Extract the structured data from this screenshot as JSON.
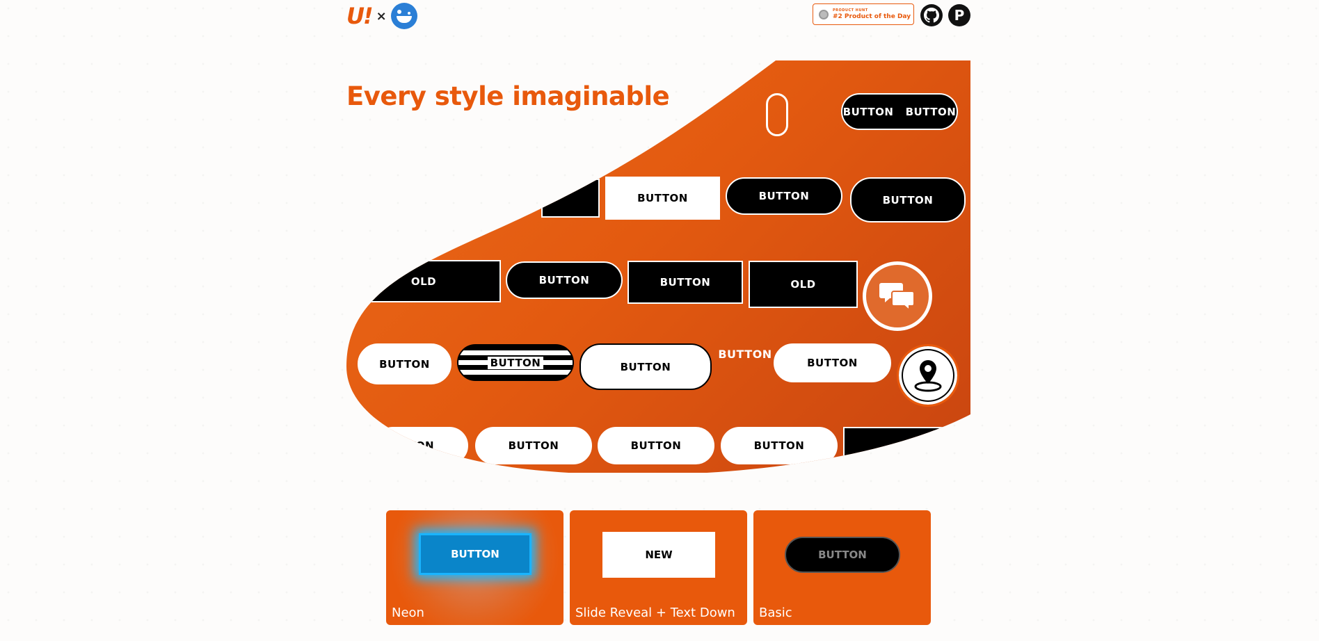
{
  "header": {
    "logo_text": "U!",
    "times": "×",
    "product_hunt_small": "PRODUCT HUNT",
    "product_hunt_label": "#2 Product of the Day",
    "github_glyph": "⌥",
    "p_glyph": "P"
  },
  "hero": {
    "title": "Every style imaginable",
    "buttons": {
      "r1a": "BUTTON",
      "r1b": "BUTTON",
      "r2a": "BUTTON",
      "r2b": "BUTTON",
      "r2c": "BUTTON",
      "r3a": "OLD",
      "r3b": "BUTTON",
      "r3c": "BUTTON",
      "r3d": "OLD",
      "r4a": "BUTTON",
      "r4b": "BUTTON",
      "r4c": "BUTTON",
      "r4d": "BUTTON",
      "r4e": "BUTTON",
      "r5a": "TON",
      "r5b": "BUTTON",
      "r5c": "BUTTON",
      "r5d": "BUTTON"
    },
    "chat_icon": "chat-bubbles",
    "map_icon": "map-pin"
  },
  "cards": [
    {
      "button": "BUTTON",
      "label": "Neon"
    },
    {
      "button": "NEW",
      "label": "Slide Reveal + Text Down"
    },
    {
      "button": "BUTTON",
      "label": "Basic"
    }
  ],
  "colors": {
    "accent": "#e8590c",
    "neon": "#19b4ff"
  }
}
